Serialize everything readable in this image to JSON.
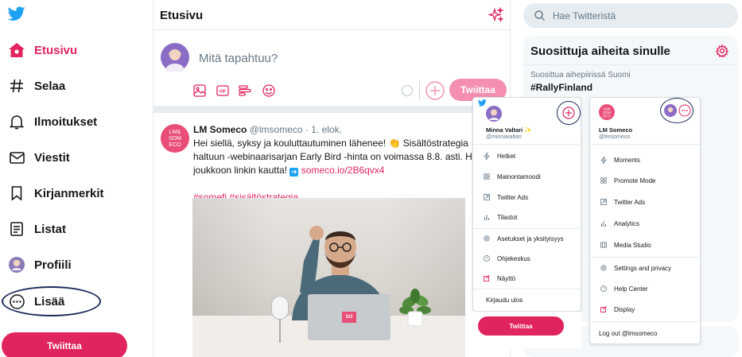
{
  "nav": {
    "items": [
      {
        "label": "Etusivu",
        "icon": "home-icon"
      },
      {
        "label": "Selaa",
        "icon": "hashtag-icon"
      },
      {
        "label": "Ilmoitukset",
        "icon": "bell-icon"
      },
      {
        "label": "Viestit",
        "icon": "mail-icon"
      },
      {
        "label": "Kirjanmerkit",
        "icon": "bookmark-icon"
      },
      {
        "label": "Listat",
        "icon": "list-icon"
      },
      {
        "label": "Profiili",
        "icon": "avatar-icon"
      },
      {
        "label": "Lisää",
        "icon": "more-icon"
      }
    ],
    "tweet_button": "Twiittaa",
    "accent": "#e0245e"
  },
  "center": {
    "title": "Etusivu",
    "composer_placeholder": "Mitä tapahtuu?",
    "composer_button": "Twiittaa",
    "tweet": {
      "author": "LM Someco",
      "handle": "@lmsomeco",
      "date": "· 1. elok.",
      "avatar_text": "LM& SOM ECO",
      "line1": "Hei siellä, syksy ja kouluttautuminen lähenee! 👏  Sisältöstrategia",
      "line2": "haltuun -webinaarisarjan Early Bird -hinta on voimassa 8.8. asti. H",
      "line3_text": "joukkoon linkin kautta! ",
      "link": "someco.io/2B6qvx4",
      "hashtags": "#somefi #sisältöstrategia",
      "laptop_logo": "SO"
    }
  },
  "right": {
    "search_placeholder": "Hae Twitteristä",
    "trends_title": "Suosittuja aiheita sinulle",
    "trend_context": "Suosittua aihepiirissä Suomi",
    "trend_name": "#RallyFinland"
  },
  "overlay_left": {
    "name": "Minna Valtari ✨",
    "handle": "@minnavaltari",
    "items": [
      "Hetket",
      "Mainontamoodi",
      "Twitter Ads",
      "Tilastot",
      "Asetukset ja yksityisyys",
      "Ohjekeskus",
      "Näyttö",
      "Kirjaudu ulos"
    ],
    "button": "Twiittaa"
  },
  "overlay_right": {
    "name": "LM Someco",
    "handle": "@lmsomeco",
    "avatar_text": "LM& SOM ECO",
    "items": [
      "Moments",
      "Promote Mode",
      "Twitter Ads",
      "Analytics",
      "Media Studio",
      "Settings and privacy",
      "Help Center",
      "Display",
      "Log out @lmsomeco"
    ]
  }
}
